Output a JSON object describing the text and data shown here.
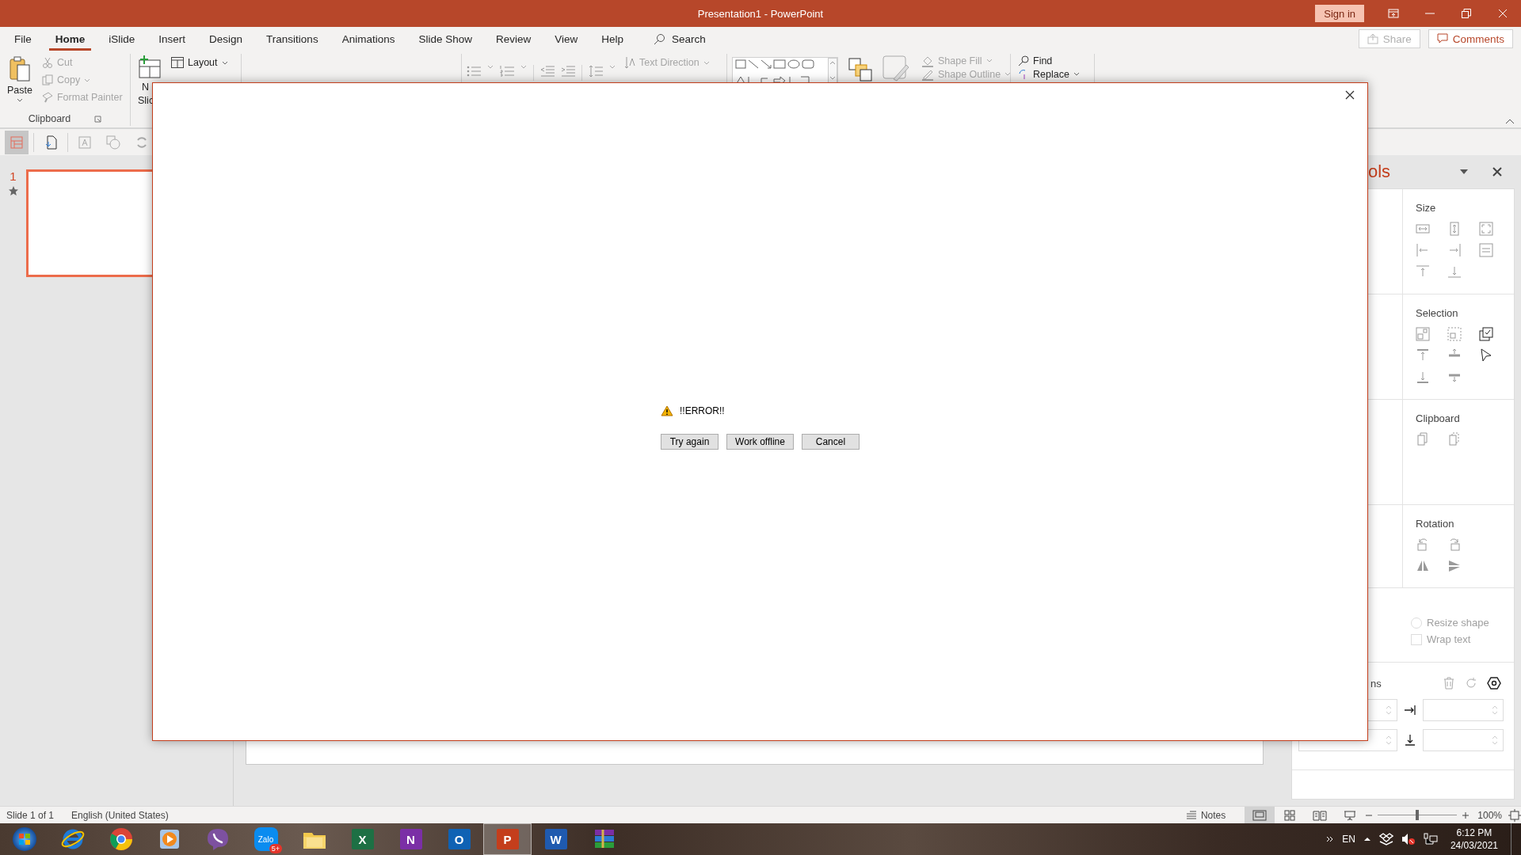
{
  "window": {
    "title": "Presentation1 - PowerPoint"
  },
  "title_bar": {
    "sign_in": "Sign in"
  },
  "menu": {
    "tabs": [
      {
        "label": "File",
        "selected": false
      },
      {
        "label": "Home",
        "selected": true
      },
      {
        "label": "iSlide",
        "selected": false
      },
      {
        "label": "Insert",
        "selected": false
      },
      {
        "label": "Design",
        "selected": false
      },
      {
        "label": "Transitions",
        "selected": false
      },
      {
        "label": "Animations",
        "selected": false
      },
      {
        "label": "Slide Show",
        "selected": false
      },
      {
        "label": "Review",
        "selected": false
      },
      {
        "label": "View",
        "selected": false
      },
      {
        "label": "Help",
        "selected": false
      }
    ],
    "search": "Search",
    "share": {
      "label": "Share",
      "disabled": true
    },
    "comments": "Comments"
  },
  "ribbon": {
    "paste": {
      "label": "Paste",
      "disabled": false
    },
    "cut": {
      "label": "Cut",
      "disabled": true
    },
    "copy": {
      "label": "Copy",
      "disabled": true
    },
    "format_painter": {
      "label": "Format Painter",
      "disabled": true
    },
    "clipboard_label": "Clipboard",
    "new_slide": {
      "lines": [
        "N",
        "Slic"
      ]
    },
    "layout": {
      "label": "Layout",
      "disabled": false
    },
    "text_direction": {
      "label": "Text Direction",
      "disabled": true
    },
    "shape_fill": {
      "label": "Shape Fill",
      "disabled": true
    },
    "shape_outline": {
      "label": "Shape Outline",
      "disabled": true
    },
    "find": {
      "label": "Find",
      "disabled": false
    },
    "replace": {
      "label": "Replace",
      "disabled": false
    }
  },
  "quick_toolbar": [
    {
      "kind": "design",
      "selected": true
    },
    {
      "kind": "export",
      "selected": false
    },
    {
      "kind": "textbox",
      "selected": false
    },
    {
      "kind": "shapes",
      "selected": false
    },
    {
      "kind": "recycle",
      "selected": false
    }
  ],
  "slides_pane": {
    "thumbnails": [
      {
        "number": "1",
        "selected": true
      }
    ]
  },
  "side_panel": {
    "title": "ols",
    "sections": [
      {
        "kind": "size",
        "title": "Size"
      },
      {
        "kind": "selection",
        "title": "Selection"
      },
      {
        "kind": "clipboard",
        "title": "Clipboard"
      },
      {
        "kind": "rotation",
        "title": "Rotation"
      }
    ],
    "options": [
      {
        "kind": "radio",
        "label": "Resize shape",
        "checked": false,
        "disabled": true
      },
      {
        "kind": "checkbox",
        "label": "Wrap text",
        "checked": false,
        "disabled": true
      }
    ],
    "position_title": "ns"
  },
  "status_bar": {
    "slide": "Slide 1 of 1",
    "language": "English (United States)",
    "notes": "Notes",
    "views": [
      {
        "kind": "normal",
        "selected": true
      },
      {
        "kind": "sorter",
        "selected": false
      },
      {
        "kind": "reading",
        "selected": false
      },
      {
        "kind": "slideshow",
        "selected": false
      }
    ],
    "zoom": {
      "level": 0.5,
      "reading": "100%"
    }
  },
  "taskbar": {
    "apps": [
      {
        "kind": "start",
        "selected": false
      },
      {
        "kind": "ie",
        "selected": false
      },
      {
        "kind": "chrome",
        "selected": false
      },
      {
        "kind": "media",
        "selected": false
      },
      {
        "kind": "viber",
        "selected": false
      },
      {
        "kind": "zalo",
        "label": "Zalo",
        "badge": "5+",
        "selected": false
      },
      {
        "kind": "explorer",
        "selected": false
      },
      {
        "kind": "tile",
        "letter": "X",
        "color": "#1d7044",
        "selected": false
      },
      {
        "kind": "tile",
        "letter": "N",
        "color": "#7b2fa6",
        "selected": false
      },
      {
        "kind": "tile",
        "letter": "O",
        "color": "#0f62b4",
        "selected": false
      },
      {
        "kind": "tile",
        "letter": "P",
        "color": "#c43e1c",
        "selected": true
      },
      {
        "kind": "tile",
        "letter": "W",
        "color": "#1f5aaf",
        "selected": false
      },
      {
        "kind": "winrar",
        "selected": false
      }
    ],
    "tray": {
      "language": "EN",
      "time": "6:12 PM",
      "date": "24/03/2021"
    }
  },
  "dialog": {
    "message": "!!ERROR!!",
    "buttons": [
      "Try again",
      "Work offline",
      "Cancel"
    ]
  }
}
